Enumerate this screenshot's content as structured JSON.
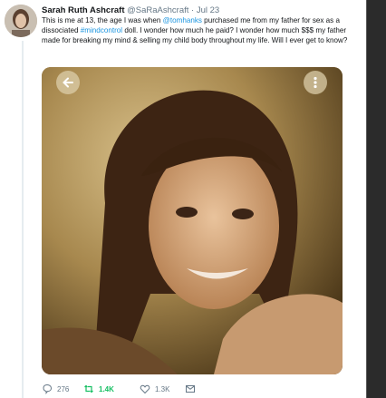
{
  "tweet": {
    "author_name": "Sarah Ruth Ashcraft",
    "handle": "@SaRaAshcraft",
    "separator": "·",
    "date": "Jul 23",
    "text_parts": {
      "p1": "This is me at 13, the age I was when ",
      "mention": "@tomhanks",
      "p2": " purchased me from my father for sex as a dissociated ",
      "hashtag": "#mindcontrol",
      "p3": " doll. I wonder how much he paid? I wonder how much $$$ my father made for breaking my mind & selling my child body throughout my life. Will I ever get to know?"
    }
  },
  "actions": {
    "replies": "276",
    "retweets": "1.4K",
    "likes": "1.3K"
  },
  "icons": {
    "back": "arrow-left-icon",
    "more": "more-vertical-icon",
    "reply": "reply-icon",
    "retweet": "retweet-icon",
    "like": "heart-icon",
    "message": "envelope-icon"
  },
  "colors": {
    "link": "#1b95e0",
    "retweet_active": "#17bf63",
    "muted": "#657786"
  }
}
